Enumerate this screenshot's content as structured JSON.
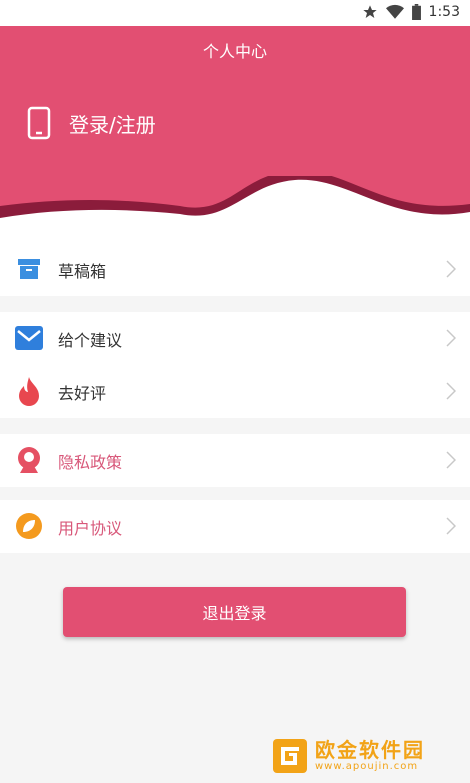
{
  "status_bar": {
    "time": "1:53",
    "icons": [
      "star-icon",
      "wifi-icon",
      "battery-icon"
    ]
  },
  "header": {
    "title": "个人中心",
    "login_label": "登录/注册",
    "background_color": "#e24f72"
  },
  "menu_groups": [
    {
      "items": [
        {
          "label": "草稿箱",
          "icon": "draft-box-icon"
        }
      ]
    },
    {
      "items": [
        {
          "label": "给个建议",
          "icon": "envelope-icon"
        },
        {
          "label": "去好评",
          "icon": "flame-icon"
        }
      ]
    },
    {
      "items": [
        {
          "label": "隐私政策",
          "icon": "privacy-icon"
        }
      ]
    },
    {
      "items": [
        {
          "label": "用户协议",
          "icon": "leaf-icon"
        }
      ]
    }
  ],
  "logout_label": "退出登录",
  "watermark": {
    "title": "欧金软件园",
    "url": "www.apoujin.com"
  }
}
